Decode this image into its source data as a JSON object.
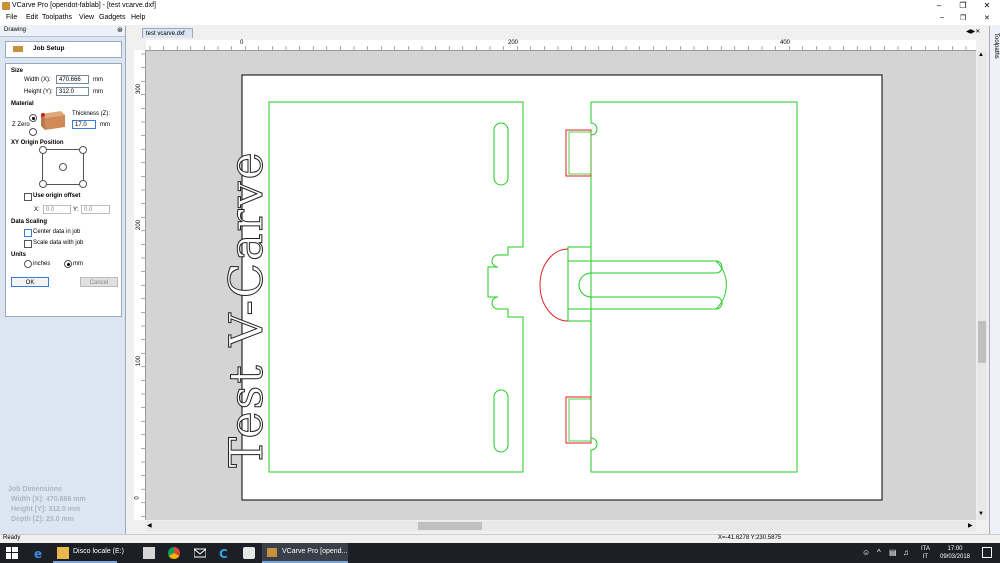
{
  "window": {
    "title": "VCarve Pro [opendot-fablab] - [test vcarve.dxf]"
  },
  "menu": [
    "File",
    "Edit",
    "Toolpaths",
    "View",
    "Gadgets",
    "Help"
  ],
  "panel": {
    "header": "Drawing",
    "job_setup": "Job Setup",
    "size": {
      "heading": "Size",
      "width_label": "Width  (X):",
      "width_value": "470.666",
      "width_unit": "mm",
      "height_label": "Height  (Y):",
      "height_value": "312.0",
      "height_unit": "mm"
    },
    "material": {
      "heading": "Material",
      "thickness_label": "Thickness (Z):",
      "thickness_value": "17.0",
      "thickness_unit": "mm",
      "zzero_label": "Z Zero"
    },
    "xy_origin": {
      "heading": "XY Origin Position",
      "use_offset_label": "Use origin offset",
      "x_label": "X:",
      "x_value": "0.0",
      "y_label": "Y:",
      "y_value": "0.0"
    },
    "data_scaling": {
      "heading": "Data Scaling",
      "center_label": "Center data in job",
      "scale_label": "Scale data with job"
    },
    "units": {
      "heading": "Units",
      "inches": "inches",
      "mm": "mm"
    },
    "ok": "OK",
    "cancel": "Cancel",
    "job_dimensions": {
      "heading": "Job Dimensions",
      "width": "Width   [X]: 470.666 mm",
      "height": "Height  [Y]: 312.0 mm",
      "depth": "Depth   [Z]: 25.0 mm"
    }
  },
  "document": {
    "tab": "test vcarve.dxf",
    "hruler_labels": [
      "0",
      "200",
      "400"
    ],
    "vruler_labels": [
      "300",
      "200",
      "100",
      "0"
    ],
    "drawing_text": "Test V-Carve",
    "toolpaths_tab": "Toolpaths"
  },
  "statusbar": {
    "left": "Ready",
    "coords": "X=-41.6278 Y:230.5875"
  },
  "taskbar": {
    "explorer_label": "Disco locale (E:)",
    "vcarve_label": "VCarve Pro [opend...",
    "lang_top": "ITA",
    "lang_bottom": "IT",
    "time": "17:00",
    "date": "09/03/2018"
  }
}
